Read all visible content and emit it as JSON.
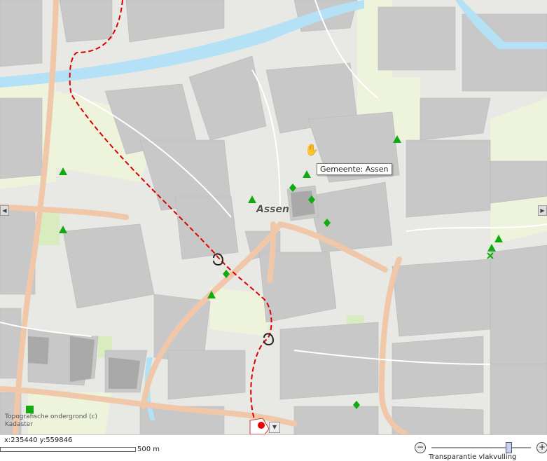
{
  "map": {
    "place_label": "Assen",
    "tooltip": "Gemeente: Assen",
    "attribution_line1": "Topografische ondergrond (c)",
    "attribution_line2": "Kadaster",
    "pan_left_icon": "triangle-left-icon",
    "pan_right_icon": "triangle-right-icon",
    "legend_toggle_icon": "chevron-down-icon",
    "cursor_icon": "hand-cursor-icon",
    "colors": {
      "background": "#e8e8e4",
      "building": "#c8c8c8",
      "water": "#b4e1f5",
      "green": "#d8ecc0",
      "pale_green": "#eef3dc",
      "main_road": "#f0c7a8",
      "route": "#dd0000",
      "marker": "#11aa11"
    }
  },
  "footer": {
    "coords": "x:235440 y:559846",
    "scale_label": "500 m",
    "zoom_out_icon": "zoom-out-icon",
    "zoom_in_icon": "zoom-in-icon",
    "slider_label": "Transparantie vlakvulling",
    "transparency_level": 0.78
  }
}
